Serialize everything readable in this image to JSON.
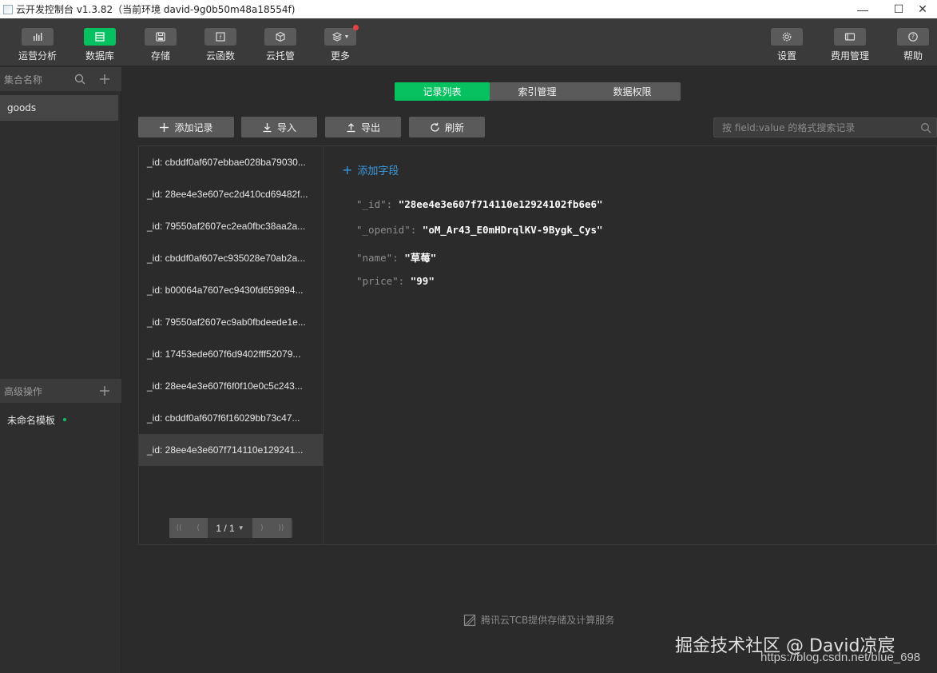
{
  "window": {
    "title": "云开发控制台 v1.3.82（当前环境 david-9g0b50m48a18554f)"
  },
  "toolbar": {
    "left": [
      {
        "label": "运营分析",
        "icon": "bar-chart-icon"
      },
      {
        "label": "数据库",
        "icon": "database-icon",
        "active": true
      },
      {
        "label": "存储",
        "icon": "storage-icon"
      },
      {
        "label": "云函数",
        "icon": "function-icon"
      },
      {
        "label": "云托管",
        "icon": "cube-icon"
      },
      {
        "label": "更多",
        "icon": "layers-icon"
      }
    ],
    "right": [
      {
        "label": "设置",
        "icon": "gear-icon"
      },
      {
        "label": "费用管理",
        "icon": "billing-icon"
      },
      {
        "label": "帮助",
        "icon": "help-icon"
      }
    ]
  },
  "sidebar": {
    "collections_header": "集合名称",
    "collections": [
      "goods"
    ],
    "advanced_header": "高级操作",
    "templates": [
      "未命名模板"
    ]
  },
  "tabs": [
    "记录列表",
    "索引管理",
    "数据权限"
  ],
  "actions": {
    "add_record": "添加记录",
    "import": "导入",
    "export": "导出",
    "refresh": "刷新"
  },
  "search": {
    "placeholder": "按 field:value 的格式搜索记录"
  },
  "records": [
    "_id: cbddf0af607ebbae028ba79030...",
    "_id: 28ee4e3e607ec2d410cd69482f...",
    "_id: 79550af2607ec2ea0fbc38aa2a...",
    "_id: cbddf0af607ec935028e70ab2a...",
    "_id: b00064a7607ec9430fd659894...",
    "_id: 79550af2607ec9ab0fbdeede1e...",
    "_id: 17453ede607f6d9402fff52079...",
    "_id: 28ee4e3e607f6f0f10e0c5c243...",
    "_id: cbddf0af607f6f16029bb73c47...",
    "_id: 28ee4e3e607f714110e129241..."
  ],
  "pager": {
    "page": "1 / 1"
  },
  "detail": {
    "add_field": "添加字段",
    "fields": [
      {
        "key": "\"_id\":",
        "value": "\"28ee4e3e607f714110e12924102fb6e6\""
      },
      {
        "key": "\"_openid\":",
        "value": "\"oM_Ar43_E0mHDrqlKV-9Bygk_Cys\""
      },
      {
        "key": "\"name\":",
        "value": "\"草莓\""
      },
      {
        "key": "\"price\":",
        "value": "\"99\""
      }
    ]
  },
  "footer": {
    "text": "腾讯云TCB提供存储及计算服务"
  },
  "watermark": {
    "line1": "掘金技术社区 @ David凉宸",
    "line2": "https://blog.csdn.net/blue_698"
  },
  "colors": {
    "accent": "#07c160",
    "link": "#3a9be0",
    "badge": "#e64340"
  }
}
